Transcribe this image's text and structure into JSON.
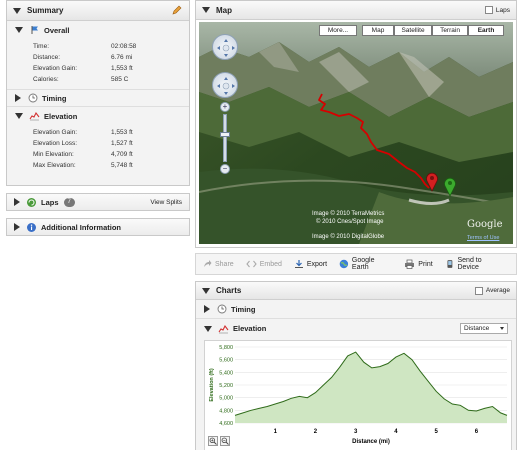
{
  "summary": {
    "title": "Summary",
    "overall": {
      "label": "Overall",
      "rows": [
        {
          "key": "Time:",
          "value": "02:08:58"
        },
        {
          "key": "Distance:",
          "value": "6.76 mi"
        },
        {
          "key": "Elevation Gain:",
          "value": "1,553 ft"
        },
        {
          "key": "Calories:",
          "value": "585 C"
        }
      ]
    },
    "timing_label": "Timing",
    "elevation": {
      "label": "Elevation",
      "rows": [
        {
          "key": "Elevation Gain:",
          "value": "1,553 ft"
        },
        {
          "key": "Elevation Loss:",
          "value": "1,527 ft"
        },
        {
          "key": "Min Elevation:",
          "value": "4,709 ft"
        },
        {
          "key": "Max Elevation:",
          "value": "5,748 ft"
        }
      ]
    }
  },
  "laps": {
    "label": "Laps",
    "count": "7",
    "view_splits": "View Splits"
  },
  "additional": {
    "label": "Additional Information"
  },
  "map": {
    "title": "Map",
    "laps_checkbox": "Laps",
    "more_button": "More...",
    "map_types": [
      "Map",
      "Satellite",
      "Terrain",
      "Earth"
    ],
    "active_type": "Earth",
    "attribution": [
      "Image © 2010 TerraMetrics",
      "© 2010 Cnes/Spot Image",
      "Image © 2010 DigitalGlobe"
    ],
    "google": "Google",
    "terms": "Terms of Use"
  },
  "toolbar": {
    "share": "Share",
    "embed": "Embed",
    "export": "Export",
    "google_earth": "Google Earth",
    "print": "Print",
    "send": "Send to Device"
  },
  "charts": {
    "title": "Charts",
    "average": "Average",
    "timing": "Timing",
    "elevation": "Elevation",
    "dropdown": "Distance"
  },
  "colors": {
    "route": "#d60000",
    "elevation_line": "#2f6b1a",
    "elevation_fill": "#cfe6c2",
    "axis_text": "#2f6b1a"
  },
  "chart_data": {
    "type": "area",
    "ylabel": "Elevation (ft)",
    "xlabel": "Distance (mi)",
    "ylim": [
      4600,
      5800
    ],
    "xlim": [
      0,
      6.76
    ],
    "yticks": [
      "5,800",
      "5,600",
      "5,400",
      "5,200",
      "5,000",
      "4,800",
      "4,600"
    ],
    "xticks": [
      "1",
      "2",
      "3",
      "4",
      "5",
      "6"
    ],
    "x": [
      0,
      0.2,
      0.4,
      0.6,
      0.8,
      1.0,
      1.2,
      1.4,
      1.6,
      1.8,
      2.0,
      2.2,
      2.4,
      2.6,
      2.8,
      3.0,
      3.2,
      3.4,
      3.6,
      3.8,
      4.0,
      4.2,
      4.4,
      4.6,
      4.8,
      5.0,
      5.2,
      5.4,
      5.6,
      5.8,
      6.0,
      6.2,
      6.4,
      6.6,
      6.76
    ],
    "y": [
      4720,
      4760,
      4800,
      4830,
      4860,
      4900,
      4940,
      4990,
      5020,
      5000,
      5080,
      5200,
      5320,
      5480,
      5660,
      5720,
      5560,
      5470,
      5490,
      5540,
      5640,
      5700,
      5600,
      5420,
      5260,
      5100,
      4980,
      4900,
      4880,
      4800,
      4790,
      4830,
      4860,
      4760,
      4720
    ]
  }
}
